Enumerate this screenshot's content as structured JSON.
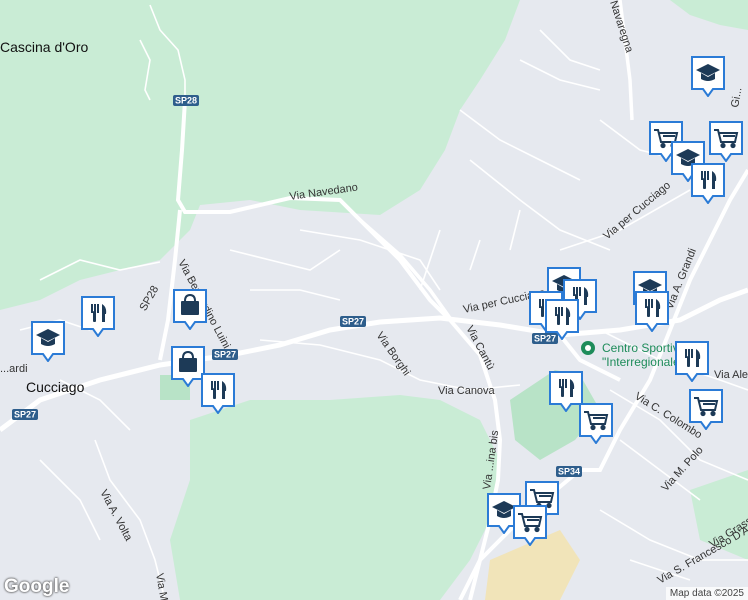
{
  "map": {
    "places": {
      "cascina": "Cascina d'Oro",
      "cucciago": "Cucciago"
    },
    "streets": {
      "navedano": "Via Navedano",
      "bernardino": "Via Bernardino Luini",
      "borghi": "Via Borghi",
      "canova": "Via Canova",
      "cantu": "Via Cantù",
      "cucciago_north": "Via per Cucciago",
      "cucciago_mid": "Via per Cucciago",
      "grandi": "Via A. Grandi",
      "colombo": "Via C. Colombo",
      "polo": "Via M. Polo",
      "francesco": "Via S. Francesco D'Assisi",
      "grassi": "Via Grassi",
      "volta": "Via A. Volta",
      "navaregna": "Navaregna",
      "bis": "Via ...ina bis",
      "alessi": "Via Alessi",
      "ardi": "...ardi",
      "vm": "Via M...",
      "gi": "Gi..."
    },
    "shields": {
      "sp28a": "SP28",
      "sp28b": "SP28",
      "sp27a": "SP27",
      "sp27b": "SP27",
      "sp27c": "SP27",
      "sp27d": "SP27",
      "sp34": "SP34"
    },
    "poi_labels": {
      "sports_line1": "Centro Sportivo",
      "sports_line2": "\"Interregionale\""
    },
    "attribution": "Map data ©2025",
    "logo": "Google"
  },
  "colors": {
    "land": "#e6e9ef",
    "park": "#c9ecd5",
    "park_dark": "#b8e3c7",
    "road": "#ffffff",
    "road_major": "#ffffff",
    "pin_border": "#2b7bd6",
    "pin_icon": "#1d3a57"
  },
  "poi_icons": [
    "education-icon",
    "restaurant-icon",
    "shopping-bag-icon",
    "shopping-bag-icon",
    "restaurant-icon",
    "education-icon",
    "restaurant-icon",
    "restaurant-icon",
    "restaurant-icon",
    "education-icon",
    "restaurant-icon",
    "restaurant-icon",
    "restaurant-icon",
    "shopping-cart-icon",
    "shopping-cart-icon",
    "shopping-cart-icon",
    "education-icon",
    "shopping-cart-icon"
  ]
}
